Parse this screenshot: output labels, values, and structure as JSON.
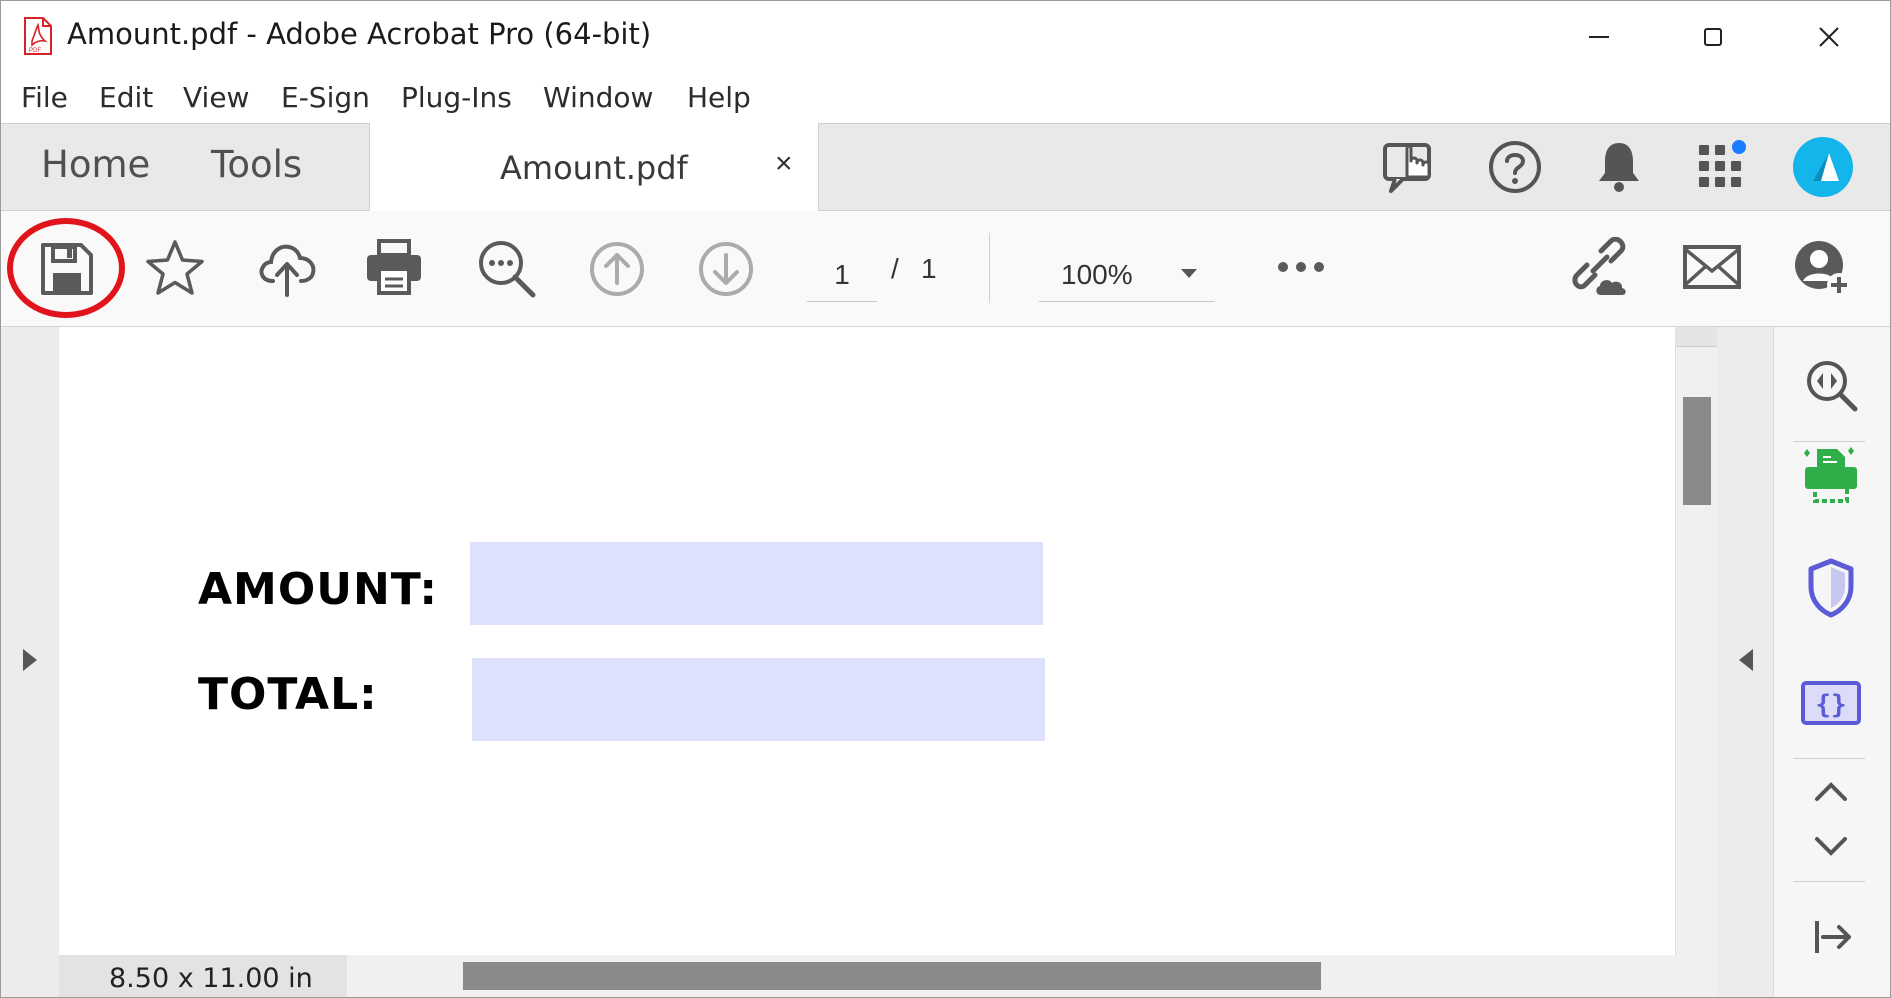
{
  "window": {
    "title": "Amount.pdf - Adobe Acrobat Pro (64-bit)",
    "controls": [
      "minimize",
      "maximize",
      "close"
    ]
  },
  "menu": {
    "items": [
      "File",
      "Edit",
      "View",
      "E-Sign",
      "Plug-Ins",
      "Window",
      "Help"
    ]
  },
  "tabs": {
    "home": "Home",
    "tools": "Tools",
    "document": "Amount.pdf",
    "close": "×"
  },
  "header_icons": [
    "share-review-icon",
    "help-icon",
    "notifications-bell-icon",
    "apps-grid-icon",
    "user-avatar"
  ],
  "toolbar": {
    "icons": [
      "save-icon",
      "bookmark-star-icon",
      "upload-cloud-icon",
      "print-icon",
      "find-search-icon",
      "previous-page-icon",
      "next-page-icon",
      "more-options-icon",
      "share-link-icon",
      "email-icon",
      "add-user-icon"
    ],
    "page_current": "1",
    "page_separator": "/",
    "page_total": "1",
    "zoom": "100%"
  },
  "document": {
    "fields": [
      {
        "label": "AMOUNT:",
        "value": ""
      },
      {
        "label": "TOTAL:",
        "value": ""
      }
    ]
  },
  "right_panel": {
    "icons": [
      "zoom-search-icon",
      "print-production-icon",
      "protect-shield-icon",
      "json-braces-icon",
      "scroll-up-icon",
      "scroll-down-icon",
      "collapse-panel-icon"
    ]
  },
  "status": {
    "page_size": "8.50 x 11.00 in"
  },
  "colors": {
    "field_fill": "#dde1fb",
    "highlight_ring": "#e2141b",
    "accent_blue": "#1a7cff",
    "avatar": "#14b5ea",
    "green_tool": "#2fae4a",
    "purple_tool": "#5b5bd8"
  }
}
